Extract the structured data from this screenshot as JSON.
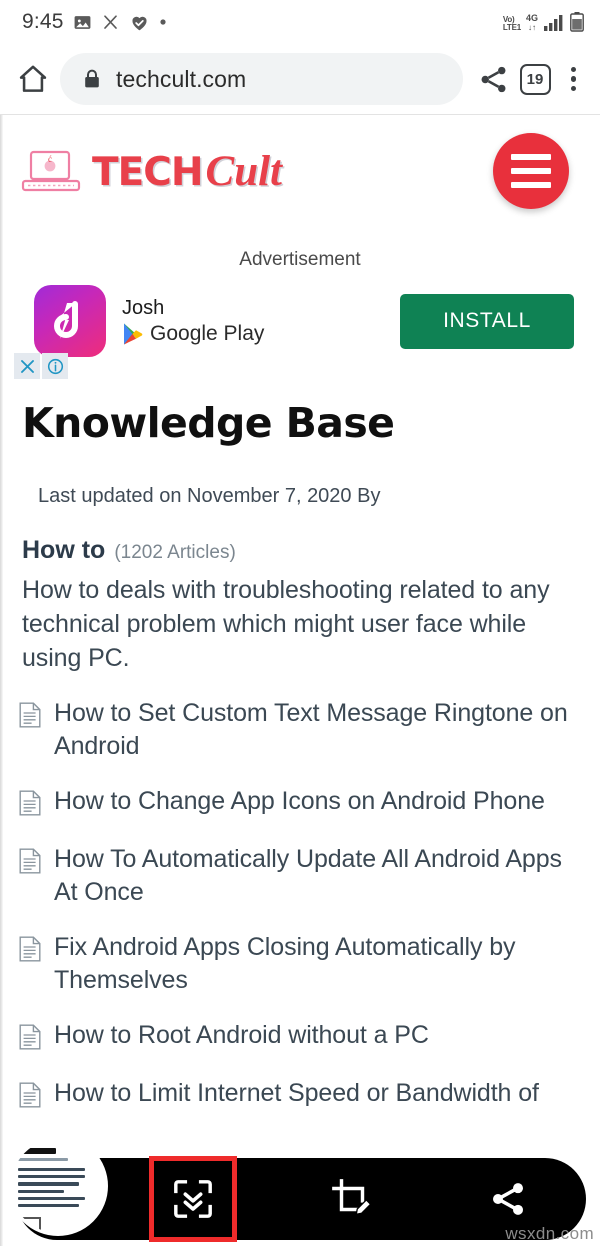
{
  "status_bar": {
    "time": "9:45",
    "icons": [
      "image-icon",
      "scissors-icon",
      "heart-check-icon",
      "dot-icon"
    ],
    "volte_top": "Vo)",
    "volte_bottom": "LTE1",
    "network_type": "4G",
    "network_arrows": "↓↑",
    "signal": "signal-bars-icon",
    "battery": "battery-icon"
  },
  "browser": {
    "home_icon": "home-icon",
    "lock_icon": "lock-icon",
    "url": "techcult.com",
    "share_icon": "share-icon",
    "tab_count": "19",
    "menu_icon": "more-vertical-icon"
  },
  "site": {
    "logo_laptop_icon": "laptop-logo-icon",
    "logo_text_primary": "TECH",
    "logo_text_secondary": "Cult",
    "menu_button": "hamburger-menu-icon",
    "brand_color": "#e8303c"
  },
  "advertisement": {
    "label": "Advertisement",
    "app_icon": "josh-app-icon",
    "app_name": "Josh",
    "store_icon": "google-play-icon",
    "store_name": "Google Play",
    "install_label": "INSTALL",
    "install_color": "#0f8254",
    "close_icon": "close-ad-icon",
    "info_icon": "ad-info-icon"
  },
  "article": {
    "title": "Knowledge Base",
    "last_updated": "Last updated on November 7, 2020 By",
    "section_name": "How to",
    "section_count": "(1202 Articles)",
    "section_description": "How to deals with troubleshooting related to any technical problem which might user face while using PC.",
    "items": [
      {
        "icon": "document-icon",
        "title": "How to Set Custom Text Message Ringtone on Android"
      },
      {
        "icon": "document-icon",
        "title": "How to Change App Icons on Android Phone"
      },
      {
        "icon": "document-icon",
        "title": "How To Automatically Update All Android Apps At Once"
      },
      {
        "icon": "document-icon",
        "title": "Fix Android Apps Closing Automatically by Themselves"
      },
      {
        "icon": "document-icon",
        "title": "How to Root Android without a PC"
      },
      {
        "icon": "document-icon",
        "title": "How to Limit Internet Speed or Bandwidth of"
      }
    ]
  },
  "screenshot_toolbar": {
    "thumbnail": "screenshot-thumbnail",
    "buttons": [
      {
        "icon": "scroll-capture-icon",
        "focused": true
      },
      {
        "icon": "crop-edit-icon",
        "focused": false
      },
      {
        "icon": "share-icon",
        "focused": false
      }
    ],
    "highlight_color": "#ef2b2b",
    "background": "#000000"
  },
  "watermark": "wsxdn.com"
}
